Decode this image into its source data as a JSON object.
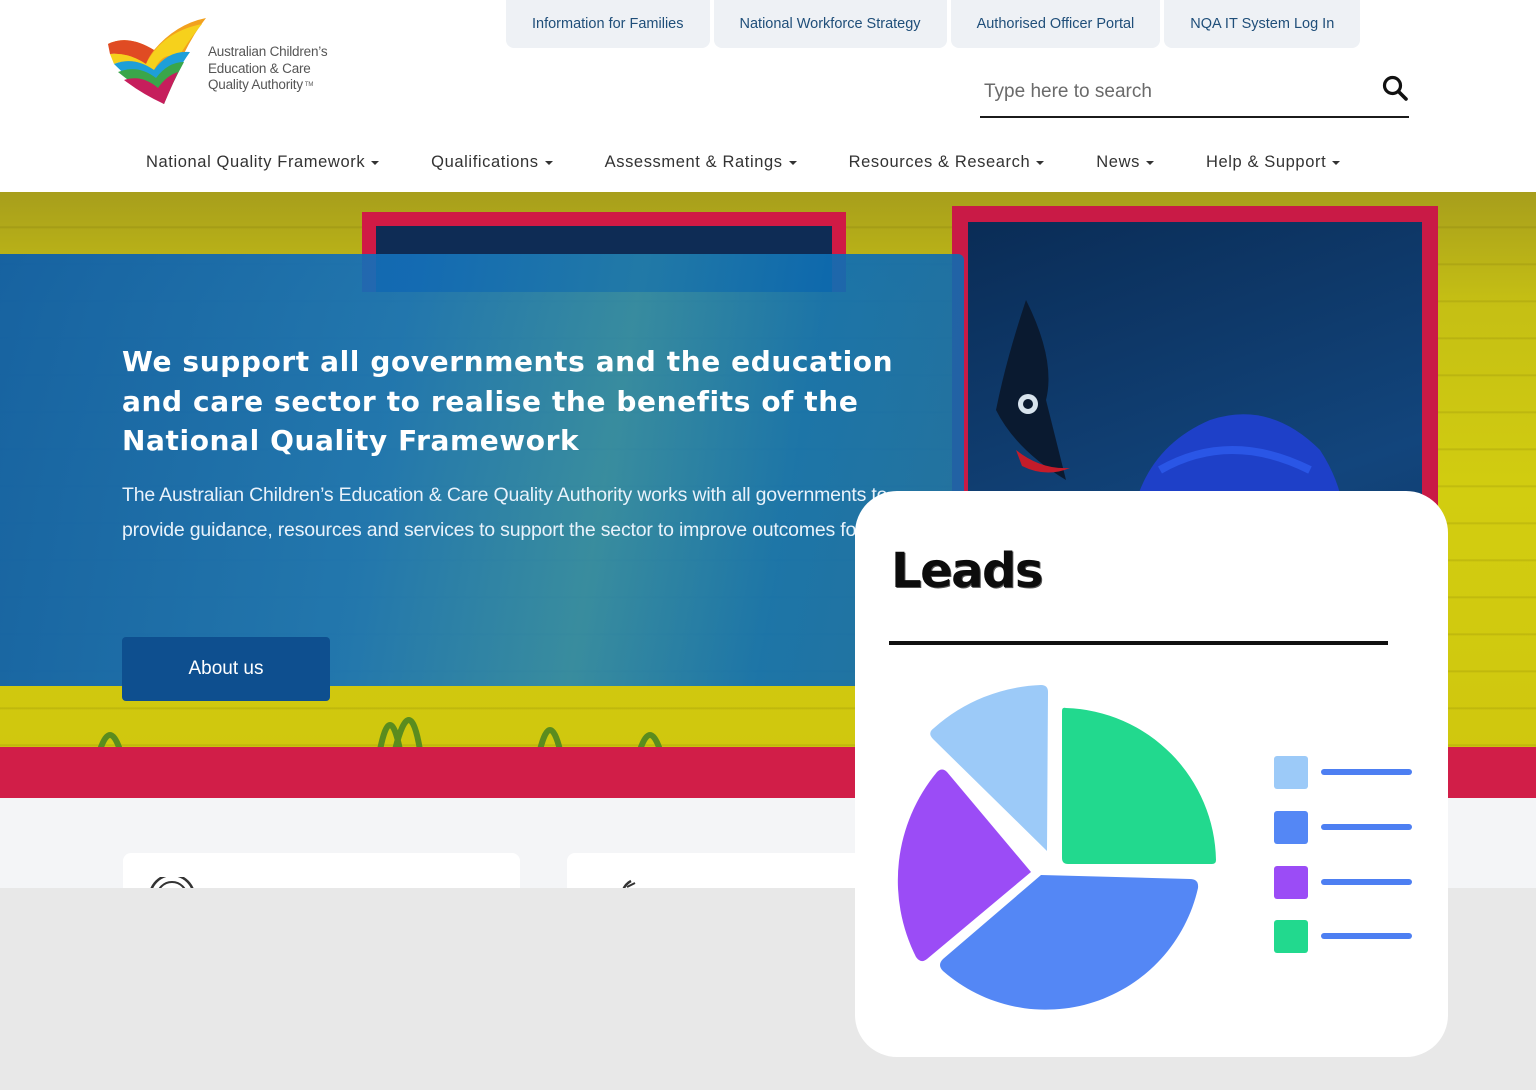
{
  "logo": {
    "lines": [
      "Australian Children’s",
      "Education & Care",
      "Quality Authority"
    ],
    "tm": "TM"
  },
  "utility_nav": [
    {
      "label": "Information for Families"
    },
    {
      "label": "National Workforce Strategy"
    },
    {
      "label": "Authorised Officer Portal"
    },
    {
      "label": "NQA IT System Log In"
    }
  ],
  "search": {
    "placeholder": "Type here to search",
    "icon": "search-icon"
  },
  "main_nav": [
    {
      "label": "National Quality Framework"
    },
    {
      "label": "Qualifications"
    },
    {
      "label": "Assessment & Ratings"
    },
    {
      "label": "Resources & Research"
    },
    {
      "label": "News"
    },
    {
      "label": "Help & Support"
    }
  ],
  "hero": {
    "title": "We support all governments and the education and care sector to realise the benefits of the National Quality Framework",
    "body": "The Australian Children’s Education & Care Quality Authority works with all governments to provide guidance, resources and services to support the sector to improve outcomes for children.",
    "button": "About us"
  },
  "leads_card": {
    "title": "Leads",
    "colors": {
      "light_blue": "#9ccaf8",
      "blue": "#5487f5",
      "purple": "#9b4cf6",
      "green": "#22d98e",
      "line": "#4d7ff2"
    }
  },
  "colors": {
    "brand_blue": "#1f4e79",
    "hero_red": "#d11e48",
    "hero_yellow": "#d2cd10"
  }
}
